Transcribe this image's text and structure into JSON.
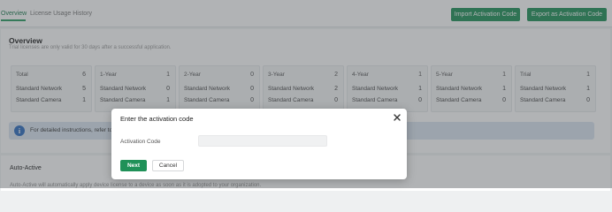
{
  "tabs": [
    {
      "label": "Overview",
      "active": true
    },
    {
      "label": "License Usage History",
      "active": false
    }
  ],
  "toolbar": {
    "import_label": "Import Activation Code",
    "export_label": "Export as Activation Code"
  },
  "overview": {
    "title": "Overview",
    "subtitle": "Trial licenses are only valid for 30 days after a successful application."
  },
  "licenses": [
    {
      "label": "Total",
      "total": "6",
      "network_label": "Standard Network",
      "network": "5",
      "camera_label": "Standard Camera",
      "camera": "1"
    },
    {
      "label": "1-Year",
      "total": "1",
      "network_label": "Standard Network",
      "network": "0",
      "camera_label": "Standard Camera",
      "camera": "1"
    },
    {
      "label": "2-Year",
      "total": "0",
      "network_label": "Standard Network",
      "network": "0",
      "camera_label": "Standard Camera",
      "camera": "0"
    },
    {
      "label": "3-Year",
      "total": "2",
      "network_label": "Standard Network",
      "network": "2",
      "camera_label": "Standard Camera",
      "camera": "0"
    },
    {
      "label": "4-Year",
      "total": "1",
      "network_label": "Standard Network",
      "network": "1",
      "camera_label": "Standard Camera",
      "camera": "0"
    },
    {
      "label": "5-Year",
      "total": "1",
      "network_label": "Standard Network",
      "network": "1",
      "camera_label": "Standard Camera",
      "camera": "0"
    },
    {
      "label": "Trial",
      "total": "1",
      "network_label": "Standard Network",
      "network": "1",
      "camera_label": "Standard Camera",
      "camera": "0"
    }
  ],
  "info": {
    "text": "For detailed instructions, refer to C",
    "icon": "info-icon"
  },
  "auto_active": {
    "title": "Auto-Active",
    "description": "Auto-Active will automatically apply device license to a device as soon as it is adopted to your organization."
  },
  "modal": {
    "title": "Enter the activation code",
    "field_label": "Activation Code",
    "field_value": "",
    "field_placeholder": "",
    "next_label": "Next",
    "cancel_label": "Cancel",
    "close_icon": "close-icon"
  },
  "colors": {
    "accent": "#1f9158",
    "info_bg": "#dbe6f2",
    "overlay": "rgba(70,74,78,0.42)"
  }
}
